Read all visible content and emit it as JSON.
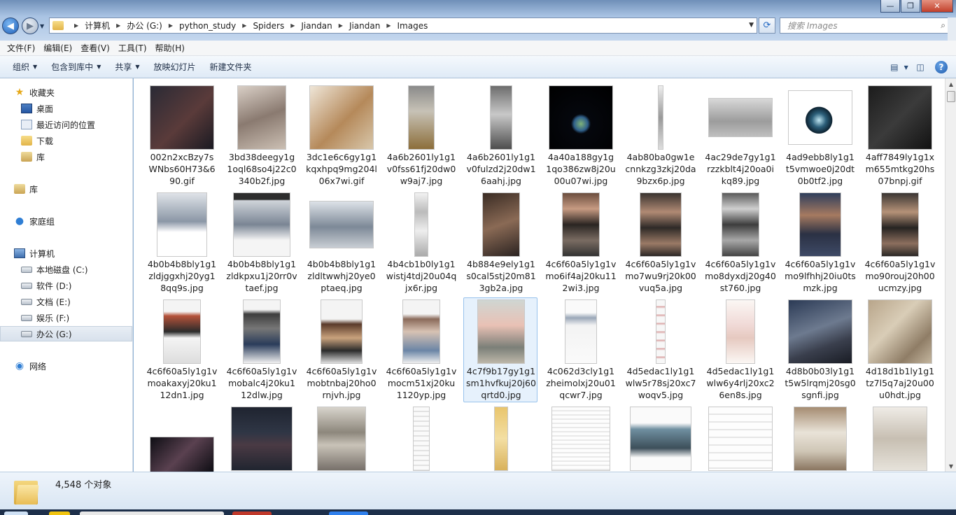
{
  "window": {
    "controls": {
      "minimize": "—",
      "maximize": "❐",
      "close": "✕"
    }
  },
  "address": {
    "crumbs": [
      "计算机",
      "办公 (G:)",
      "python_study",
      "Spiders",
      "Jiandan",
      "Jiandan",
      "Images"
    ],
    "search_placeholder": "搜索 Images"
  },
  "menu": [
    "文件(F)",
    "编辑(E)",
    "查看(V)",
    "工具(T)",
    "帮助(H)"
  ],
  "toolbar": {
    "organize": "组织",
    "include_library": "包含到库中",
    "share": "共享",
    "slideshow": "放映幻灯片",
    "new_folder": "新建文件夹"
  },
  "sidebar": {
    "favorites": "收藏夹",
    "desktop": "桌面",
    "recent": "最近访问的位置",
    "downloads": "下载",
    "library_fav": "库",
    "libraries": "库",
    "homegroup": "家庭组",
    "computer": "计算机",
    "drive_c": "本地磁盘 (C:)",
    "drive_d": "软件 (D:)",
    "drive_e": "文档 (E:)",
    "drive_f": "娱乐 (F:)",
    "drive_g": "办公 (G:)",
    "network": "网络"
  },
  "files": [
    "002n2xcBzy7sWNbs60H73&690.gif",
    "3bd38deegy1g1oql68so4j22c0340b2f.jpg",
    "3dc1e6c6gy1g1kqxhpq9mg204l06x7wi.gif",
    "4a6b2601ly1g1v0fss61fj20dw0w9aj7.jpg",
    "4a6b2601ly1g1v0fulzd2j20dw16aahj.jpg",
    "4a40a188gy1g1qo386zw8j20u00u07wi.jpg",
    "4ab80ba0gw1ecnnkzg3zkj20da9bzx6p.jpg",
    "4ac29de7gy1g1rzzkblt4j20oa0ikq89.jpg",
    "4ad9ebb8ly1g1t5vmwoe0j20dt0b0tf2.jpg",
    "4aff7849ly1g1xm655mtkg20hs07bnpj.gif",
    "4b0b4b8bly1g1zldjggxhj20yg18qq9s.jpg",
    "4b0b4b8bly1g1zldkpxu1j20rr0vtaef.jpg",
    "4b0b4b8bly1g1zldltwwhj20ye0ptaeq.jpg",
    "4b4cb1b0ly1g1wistj4tdj20u04qjx6r.jpg",
    "4b884e9ely1g1s0cal5stj20m813gb2a.jpg",
    "4c6f60a5ly1g1vmo6if4aj20ku112wi3.jpg",
    "4c6f60a5ly1g1vmo7wu9rj20k00vuq5a.jpg",
    "4c6f60a5ly1g1vmo8dyxdj20g40st760.jpg",
    "4c6f60a5ly1g1vmo9lfhhj20iu0tsmzk.jpg",
    "4c6f60a5ly1g1vmo90rouj20h00ucmzy.jpg",
    "4c6f60a5ly1g1vmoakaxyj20ku112dn1.jpg",
    "4c6f60a5ly1g1vmobalc4j20ku112dlw.jpg",
    "4c6f60a5ly1g1vmobtnbaj20ho0rnjvh.jpg",
    "4c6f60a5ly1g1vmocm51xj20ku1120yp.jpg",
    "4c7f9b17gy1g1sm1hvfkuj20j60qrtd0.jpg",
    "4c062d3cly1g1zheimolxj20u01qcwr7.jpg",
    "4d5edac1ly1g1wlw5r78sj20xc7woqv5.jpg",
    "4d5edac1ly1g1wlw6y4rlj20xc26en8s.jpg",
    "4d8b0b03ly1g1t5w5lrqmj20sg0sgnfi.jpg",
    "4d18d1b1ly1g1tz7l5q7aj20u00u0hdt.jpg"
  ],
  "status": {
    "count": "4,548 个对象"
  },
  "colors": {
    "chrome": "#a9c3e3",
    "selection": "#e6f1fc",
    "selection_border": "#98c2ec"
  }
}
